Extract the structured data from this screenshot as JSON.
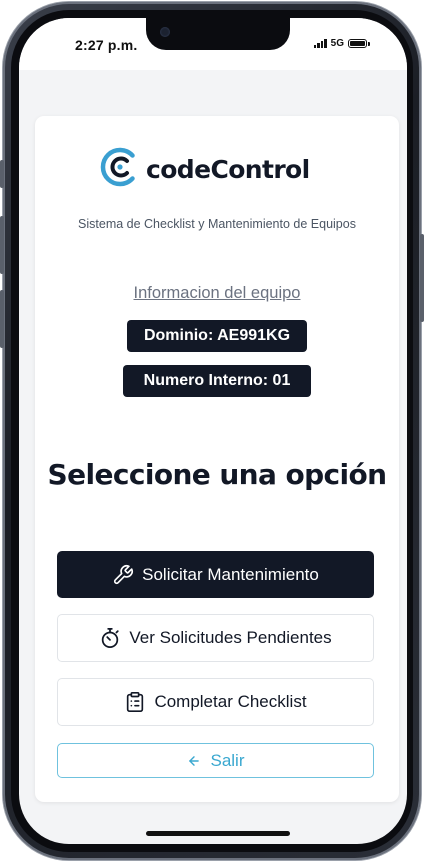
{
  "status_bar": {
    "time": "2:27 p.m.",
    "network": "5G"
  },
  "brand": {
    "name": "codeControl",
    "logo_icon": "code-c-logo-icon",
    "accent_color": "#3a9fd1"
  },
  "subtitle": "Sistema de Checklist y Mantenimiento de Equipos",
  "equipment": {
    "link_label": "Informacion del equipo",
    "dominio": "Dominio: AE991KG",
    "numero_interno": "Numero Interno: 01"
  },
  "heading": "Seleccione una opción",
  "actions": {
    "request_maintenance": {
      "label": "Solicitar Mantenimiento",
      "icon": "wrench-icon"
    },
    "pending_requests": {
      "label": "Ver Solicitudes Pendientes",
      "icon": "stopwatch-icon"
    },
    "complete_checklist": {
      "label": "Completar Checklist",
      "icon": "clipboard-list-icon"
    },
    "exit": {
      "label": "Salir",
      "icon": "arrow-left-icon"
    }
  },
  "colors": {
    "primary": "#121826",
    "exit_accent": "#3aa8d0"
  }
}
